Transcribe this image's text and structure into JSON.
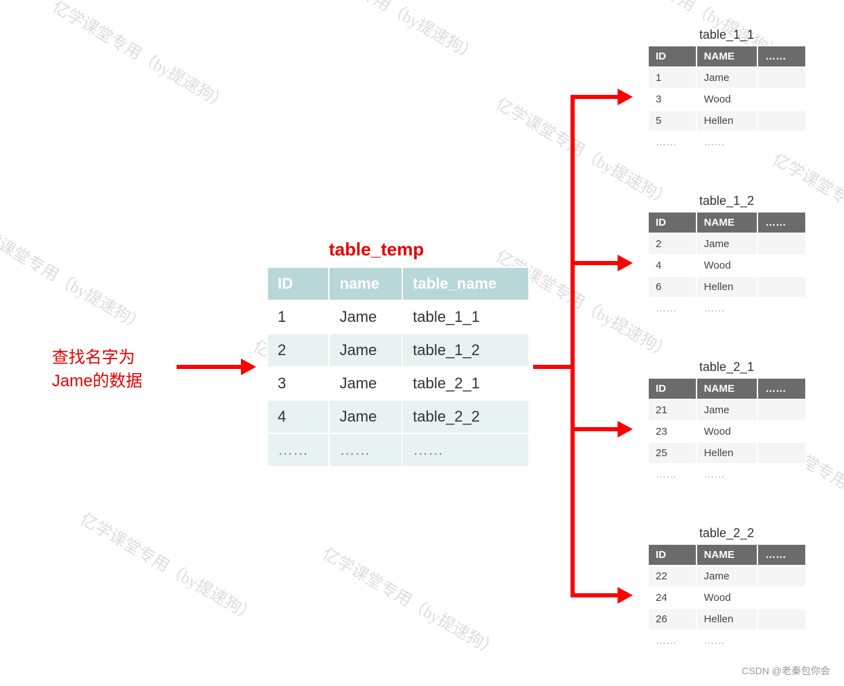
{
  "watermark": "亿学课堂专用（by提速狗）",
  "query_label_line1": "查找名字为",
  "query_label_line2": "Jame的数据",
  "temp_table_title": "table_temp",
  "temp_headers": {
    "c1": "ID",
    "c2": "name",
    "c3": "table_name"
  },
  "temp_rows": {
    "r1": {
      "id": "1",
      "name": "Jame",
      "tn": "table_1_1"
    },
    "r2": {
      "id": "2",
      "name": "Jame",
      "tn": "table_1_2"
    },
    "r3": {
      "id": "3",
      "name": "Jame",
      "tn": "table_2_1"
    },
    "r4": {
      "id": "4",
      "name": "Jame",
      "tn": "table_2_2"
    },
    "r5": {
      "id": "……",
      "name": "……",
      "tn": "……"
    }
  },
  "mini_headers": {
    "c1": "ID",
    "c2": "NAME",
    "c3": "……"
  },
  "t11": {
    "title": "table_1_1",
    "r1": {
      "id": "1",
      "name": "Jame"
    },
    "r2": {
      "id": "3",
      "name": "Wood"
    },
    "r3": {
      "id": "5",
      "name": "Hellen"
    },
    "r4": {
      "id": "……",
      "name": "……"
    }
  },
  "t12": {
    "title": "table_1_2",
    "r1": {
      "id": "2",
      "name": "Jame"
    },
    "r2": {
      "id": "4",
      "name": "Wood"
    },
    "r3": {
      "id": "6",
      "name": "Hellen"
    },
    "r4": {
      "id": "……",
      "name": "……"
    }
  },
  "t21": {
    "title": "table_2_1",
    "r1": {
      "id": "21",
      "name": "Jame"
    },
    "r2": {
      "id": "23",
      "name": "Wood"
    },
    "r3": {
      "id": "25",
      "name": "Hellen"
    },
    "r4": {
      "id": "……",
      "name": "……"
    }
  },
  "t22": {
    "title": "table_2_2",
    "r1": {
      "id": "22",
      "name": "Jame"
    },
    "r2": {
      "id": "24",
      "name": "Wood"
    },
    "r3": {
      "id": "26",
      "name": "Hellen"
    },
    "r4": {
      "id": "……",
      "name": "……"
    }
  },
  "footer": "CSDN @老秦包你会"
}
